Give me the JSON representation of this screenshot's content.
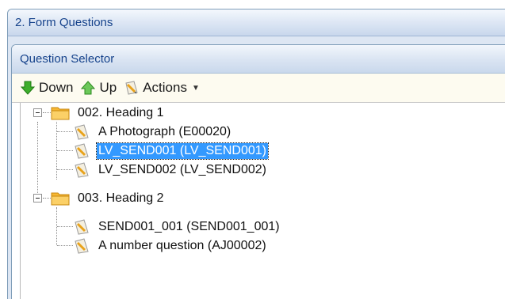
{
  "outer_panel": {
    "title": "2. Form Questions"
  },
  "inner_panel": {
    "title": "Question Selector"
  },
  "toolbar": {
    "down_label": "Down",
    "up_label": "Up",
    "actions_label": "Actions"
  },
  "tree": {
    "groups": [
      {
        "label": "002. Heading 1",
        "expanded": true,
        "items": [
          {
            "label": "A Photograph (E00020)",
            "selected": false
          },
          {
            "label": "LV_SEND001 (LV_SEND001)",
            "selected": true
          },
          {
            "label": "LV_SEND002 (LV_SEND002)",
            "selected": false
          }
        ]
      },
      {
        "label": "003. Heading 2",
        "expanded": true,
        "items": [
          {
            "label": "SEND001_001 (SEND001_001)",
            "selected": false
          },
          {
            "label": "A number question (AJ00002)",
            "selected": false
          }
        ]
      }
    ]
  },
  "colors": {
    "title_text": "#15428b",
    "selection": "#3399ff",
    "toolbar_bg": "#fdfbf0",
    "arrow_green": "#3dae2b",
    "folder_orange": "#f0a31c"
  },
  "icons": {
    "down": "arrow-down-icon",
    "up": "arrow-up-icon",
    "actions": "pencil-page-icon",
    "folder": "folder-icon",
    "question": "question-page-icon"
  }
}
